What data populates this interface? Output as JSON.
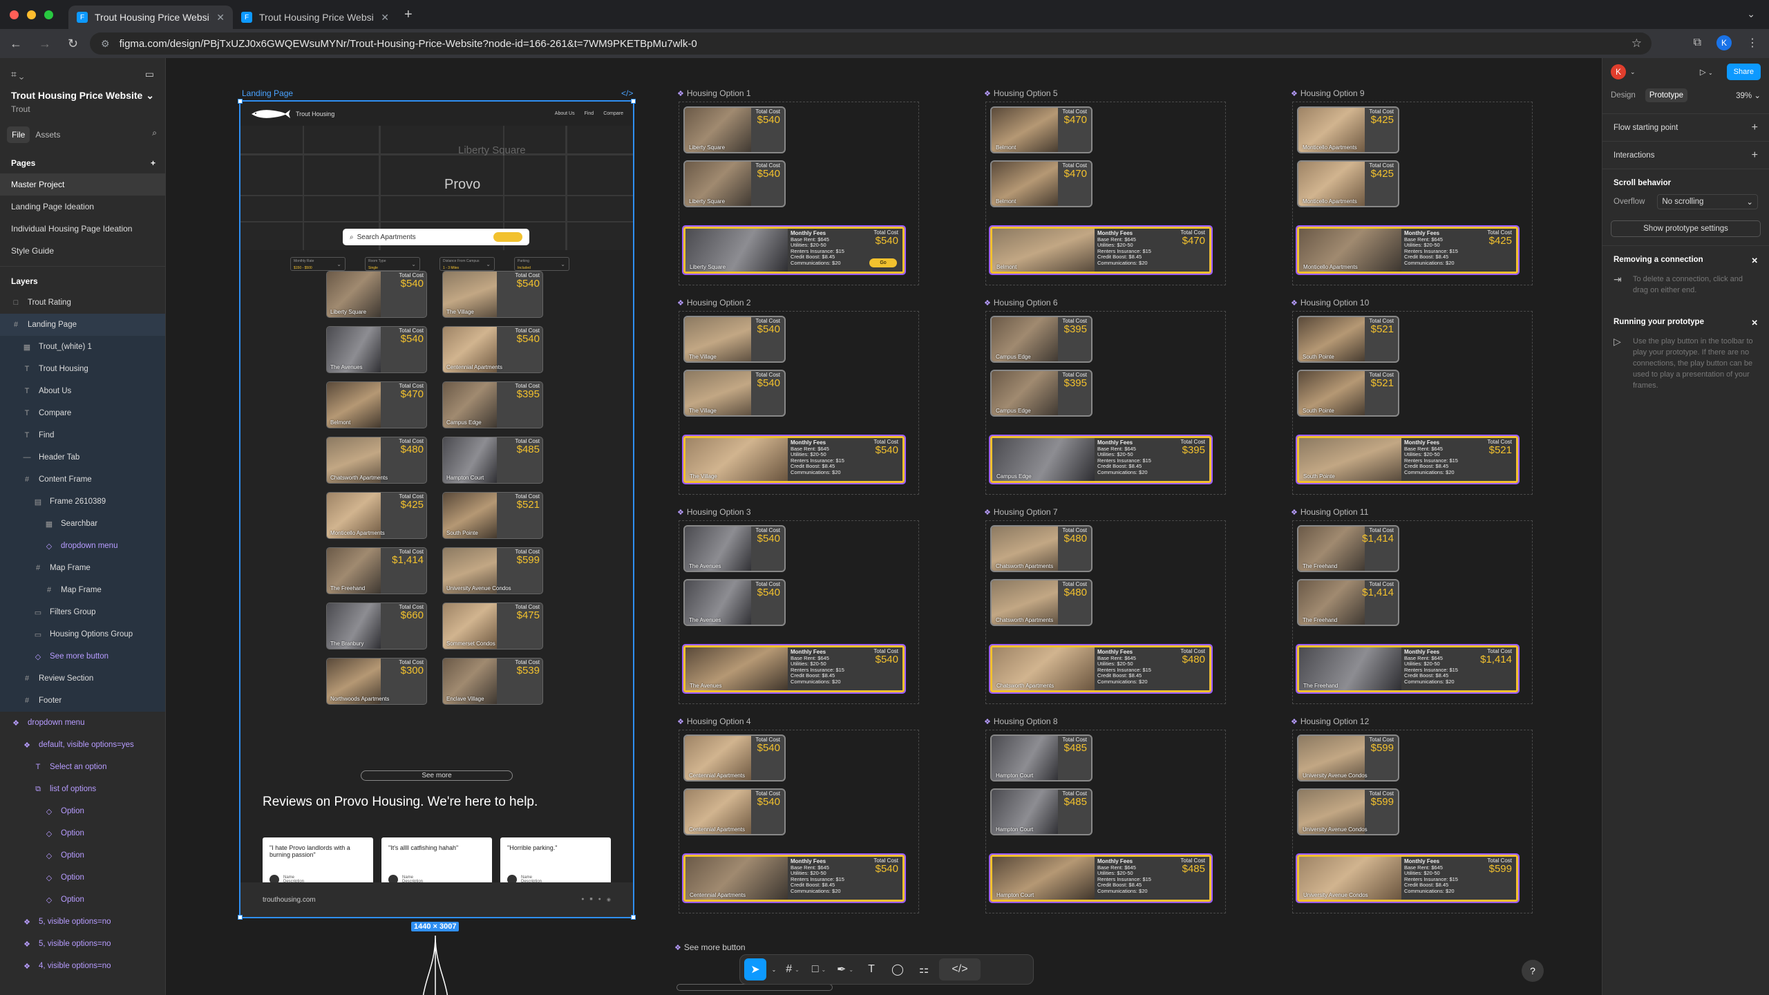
{
  "browser": {
    "tabs": [
      {
        "title": "Trout Housing Price Website",
        "active": true
      },
      {
        "title": "Trout Housing Price Website",
        "active": false
      }
    ],
    "url": "figma.com/design/PBjTxUZJ0x6GWQEWsuMYNr/Trout-Housing-Price-Website?node-id=166-261&t=7WM9PKETBpMu7wlk-0",
    "profile_initial": "K"
  },
  "left_panel": {
    "file_name": "Trout Housing Price Website",
    "project": "Trout",
    "tabs": [
      "File",
      "Assets"
    ],
    "pages_title": "Pages",
    "pages": [
      "Master Project",
      "Landing Page Ideation",
      "Individual Housing Page Ideation",
      "Style Guide"
    ],
    "layers_title": "Layers",
    "layers": [
      {
        "label": "Trout Rating",
        "icon": "□",
        "indent": 0,
        "state": ""
      },
      {
        "label": "Landing Page",
        "icon": "#",
        "indent": 0,
        "state": "sel"
      },
      {
        "label": "Trout_(white) 1",
        "icon": "▦",
        "indent": 1,
        "state": "child"
      },
      {
        "label": "Trout Housing",
        "icon": "T",
        "indent": 1,
        "state": "child"
      },
      {
        "label": "About Us",
        "icon": "T",
        "indent": 1,
        "state": "child"
      },
      {
        "label": "Compare",
        "icon": "T",
        "indent": 1,
        "state": "child"
      },
      {
        "label": "Find",
        "icon": "T",
        "indent": 1,
        "state": "child"
      },
      {
        "label": "Header Tab",
        "icon": "—",
        "indent": 1,
        "state": "child"
      },
      {
        "label": "Content Frame",
        "icon": "#",
        "indent": 1,
        "state": "child"
      },
      {
        "label": "Frame 2610389",
        "icon": "▤",
        "indent": 2,
        "state": "child"
      },
      {
        "label": "Searchbar",
        "icon": "▦",
        "indent": 3,
        "state": "child"
      },
      {
        "label": "dropdown menu",
        "icon": "◇",
        "indent": 3,
        "state": "child comp"
      },
      {
        "label": "Map Frame",
        "icon": "#",
        "indent": 2,
        "state": "child"
      },
      {
        "label": "Map Frame",
        "icon": "#",
        "indent": 3,
        "state": "child"
      },
      {
        "label": "Filters Group",
        "icon": "▭",
        "indent": 2,
        "state": "child"
      },
      {
        "label": "Housing Options Group",
        "icon": "▭",
        "indent": 2,
        "state": "child"
      },
      {
        "label": "See more button",
        "icon": "◇",
        "indent": 2,
        "state": "child comp"
      },
      {
        "label": "Review Section",
        "icon": "#",
        "indent": 1,
        "state": "child"
      },
      {
        "label": "Footer",
        "icon": "#",
        "indent": 1,
        "state": "child"
      },
      {
        "label": "dropdown menu",
        "icon": "❖",
        "indent": 0,
        "state": "comp"
      },
      {
        "label": "default, visible options=yes",
        "icon": "❖",
        "indent": 1,
        "state": "comp"
      },
      {
        "label": "Select an option",
        "icon": "T",
        "indent": 2,
        "state": "comp"
      },
      {
        "label": "list of options",
        "icon": "⧉",
        "indent": 2,
        "state": "comp"
      },
      {
        "label": "Option",
        "icon": "◇",
        "indent": 3,
        "state": "comp"
      },
      {
        "label": "Option",
        "icon": "◇",
        "indent": 3,
        "state": "comp"
      },
      {
        "label": "Option",
        "icon": "◇",
        "indent": 3,
        "state": "comp"
      },
      {
        "label": "Option",
        "icon": "◇",
        "indent": 3,
        "state": "comp"
      },
      {
        "label": "Option",
        "icon": "◇",
        "indent": 3,
        "state": "comp"
      },
      {
        "label": "5, visible options=no",
        "icon": "❖",
        "indent": 1,
        "state": "comp"
      },
      {
        "label": "5, visible options=no",
        "icon": "❖",
        "indent": 1,
        "state": "comp"
      },
      {
        "label": "4, visible options=no",
        "icon": "❖",
        "indent": 1,
        "state": "comp"
      }
    ]
  },
  "canvas": {
    "landing_label": "Landing Page",
    "landing": {
      "brand": "Trout Housing",
      "nav": [
        "About Us",
        "Find",
        "Compare"
      ],
      "map_city": "Provo",
      "map_area": "Liberty Square",
      "search_placeholder": "Search Apartments",
      "filters": [
        {
          "label": "Monthly Rate",
          "value": "$150 - $500"
        },
        {
          "label": "Room Type",
          "value": "Single"
        },
        {
          "label": "Distance From Campus",
          "value": "1 - 3 Miles"
        },
        {
          "label": "Parking",
          "value": "Included"
        }
      ],
      "total_cost_label": "Total Cost",
      "listings": [
        {
          "name": "Liberty Square",
          "price": "$540"
        },
        {
          "name": "The Village",
          "price": "$540"
        },
        {
          "name": "The Avenues",
          "price": "$540"
        },
        {
          "name": "Centennial Apartments",
          "price": "$540"
        },
        {
          "name": "Belmont",
          "price": "$470"
        },
        {
          "name": "Campus Edge",
          "price": "$395"
        },
        {
          "name": "Chatsworth Apartments",
          "price": "$480"
        },
        {
          "name": "Hampton Court",
          "price": "$485"
        },
        {
          "name": "Monticello Apartments",
          "price": "$425"
        },
        {
          "name": "South Pointe",
          "price": "$521"
        },
        {
          "name": "The Freehand",
          "price": "$1,414"
        },
        {
          "name": "University Avenue Condos",
          "price": "$599"
        },
        {
          "name": "The Branbury",
          "price": "$660"
        },
        {
          "name": "Sommerset Condos",
          "price": "$475"
        },
        {
          "name": "Northwoods Apartments",
          "price": "$300"
        },
        {
          "name": "Enclave Village",
          "price": "$539"
        }
      ],
      "see_more": "See more",
      "reviews_heading": "Reviews on Provo Housing. We're here to help.",
      "reviews": [
        {
          "quote": "\"I hate Provo landlords with a burning passion\"",
          "name": "Name",
          "desc": "Description"
        },
        {
          "quote": "\"It's allll catfishing hahah\"",
          "name": "Name",
          "desc": "Description"
        },
        {
          "quote": "\"Horrible parking.\"",
          "name": "Name",
          "desc": "Description"
        }
      ],
      "footer_url": "trouthousing.com",
      "dimensions": "1440 × 3007"
    },
    "housing_options": [
      {
        "label": "Housing Option 1",
        "name": "Liberty Square",
        "price": "$540",
        "go": "Go"
      },
      {
        "label": "Housing Option 2",
        "name": "The Village",
        "price": "$540"
      },
      {
        "label": "Housing Option 3",
        "name": "The Avenues",
        "price": "$540"
      },
      {
        "label": "Housing Option 4",
        "name": "Centennial Apartments",
        "price": "$540"
      },
      {
        "label": "Housing Option 5",
        "name": "Belmont",
        "price": "$470"
      },
      {
        "label": "Housing Option 6",
        "name": "Campus Edge",
        "price": "$395"
      },
      {
        "label": "Housing Option 7",
        "name": "Chatsworth Apartments",
        "price": "$480"
      },
      {
        "label": "Housing Option 8",
        "name": "Hampton Court",
        "price": "$485"
      },
      {
        "label": "Housing Option 9",
        "name": "Monticello Apartments",
        "price": "$425"
      },
      {
        "label": "Housing Option 10",
        "name": "South Pointe",
        "price": "$521"
      },
      {
        "label": "Housing Option 11",
        "name": "The Freehand",
        "price": "$1,414"
      },
      {
        "label": "Housing Option 12",
        "name": "University Avenue Condos",
        "price": "$599"
      }
    ],
    "fees": {
      "title": "Monthly Fees",
      "lines": [
        "Base Rent: $645",
        "Utilities: $20-50",
        "Renters Insurance: $15",
        "Credit Boost: $8.45",
        "Communications: $20"
      ]
    },
    "see_more_button_label": "See more button"
  },
  "right_panel": {
    "profile_initial": "K",
    "share": "Share",
    "tabs": [
      "Design",
      "Prototype"
    ],
    "zoom": "39%",
    "flow_starting_point": "Flow starting point",
    "interactions": "Interactions",
    "scroll_behavior": "Scroll behavior",
    "overflow_label": "Overflow",
    "overflow_value": "No scrolling",
    "show_settings": "Show prototype settings",
    "removing_title": "Removing a connection",
    "removing_text": "To delete a connection, click and drag on either end.",
    "running_title": "Running your prototype",
    "running_text": "Use the play button in the toolbar to play your prototype. If there are no connections, the play button can be used to play a presentation of your frames."
  },
  "colors": {
    "accent": "#0d99ff",
    "price": "#f2c12e",
    "highlight": "#9b5cff",
    "selection": "#2f8ff3"
  }
}
